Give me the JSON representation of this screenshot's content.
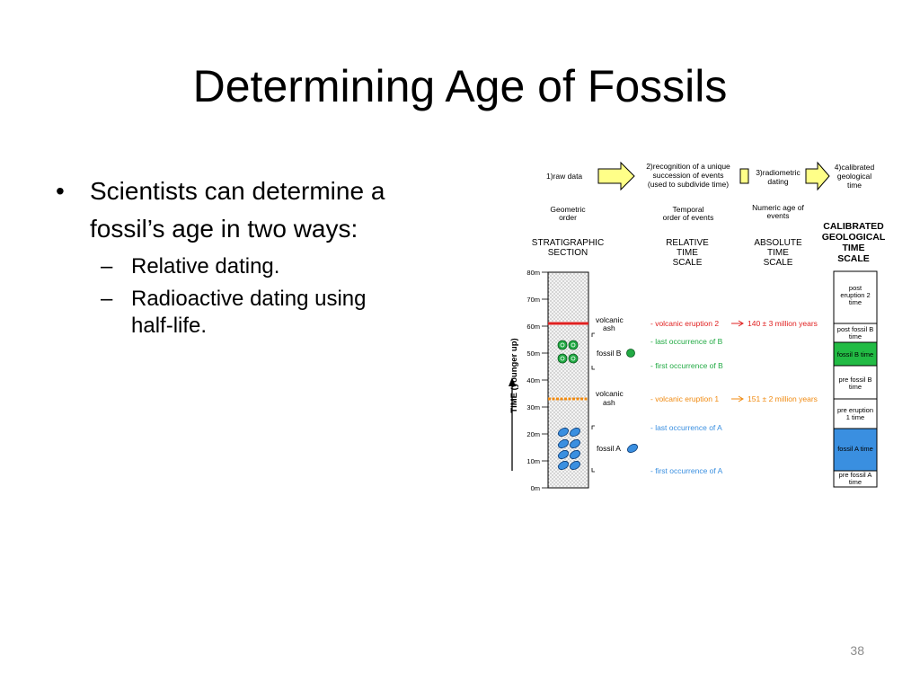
{
  "slide": {
    "title": "Determining Age of Fossils",
    "bullets": [
      {
        "text": "Scientists can determine a fossil’s age in two ways:",
        "line1": "Scientists can determine a",
        "line2": "fossil’s age in two ways:",
        "sub": [
          {
            "line1": "Relative dating."
          },
          {
            "line1": "Radioactive dating using",
            "line2": "half-life."
          }
        ]
      }
    ],
    "slide_number": "38"
  },
  "diagram": {
    "steps": {
      "s1": "1)raw data",
      "s2a": "2)recognition of a unique",
      "s2b": "succession of events",
      "s2c": "(used to subdivide time)",
      "s3a": "3)radiometric",
      "s3b": "dating",
      "s4a": "4)calibrated",
      "s4b": "geological",
      "s4c": "time"
    },
    "subheads": {
      "h1a": "Geometric",
      "h1b": "order",
      "h2a": "Temporal",
      "h2b": "order of events",
      "h3a": "Numeric age of",
      "h3b": "events"
    },
    "columns": {
      "c1a": "STRATIGRAPHIC",
      "c1b": "SECTION",
      "c2a": "RELATIVE",
      "c2b": "TIME",
      "c2c": "SCALE",
      "c3a": "ABSOLUTE",
      "c3b": "TIME",
      "c3c": "SCALE",
      "c4a": "CALIBRATED",
      "c4b": "GEOLOGICAL",
      "c4c": "TIME",
      "c4d": "SCALE"
    },
    "axis": {
      "label": "TIME (younger up)",
      "ticks": [
        "0m",
        "10m",
        "20m",
        "30m",
        "40m",
        "50m",
        "60m",
        "70m",
        "80m"
      ]
    },
    "section": {
      "ash_top_a": "volcanic",
      "ash_top_b": "ash",
      "ash_bot_a": "volcanic",
      "ash_bot_b": "ash",
      "fossil_b": "fossil B",
      "fossil_a": "fossil A"
    },
    "events": {
      "eruption2": "- volcanic eruption 2",
      "lastB": "- last occurrence of B",
      "firstB": "- first occurrence of B",
      "eruption1": "- volcanic eruption 1",
      "lastA": "- last occurrence of A",
      "firstA": "- first occurrence of A"
    },
    "ages": {
      "age2": "140 ± 3 million years",
      "age1": "151 ± 2 million years"
    },
    "scale": {
      "z1a": "post",
      "z1b": "eruption 2",
      "z1c": "time",
      "z2a": "post fossil B",
      "z2b": "time",
      "z3a": "fossil B time",
      "z4a": "pre fossil B",
      "z4b": "time",
      "z5a": "pre eruption",
      "z5b": "1 time",
      "z6a": "fossil A time",
      "z7a": "pre fossil A",
      "z7b": "time"
    },
    "colors": {
      "eruption2": "#e02020",
      "eruption1": "#f08a10",
      "fossilB": "#22aa44",
      "fossilA": "#3a8fe0",
      "arrowFill": "#ffff88"
    }
  }
}
